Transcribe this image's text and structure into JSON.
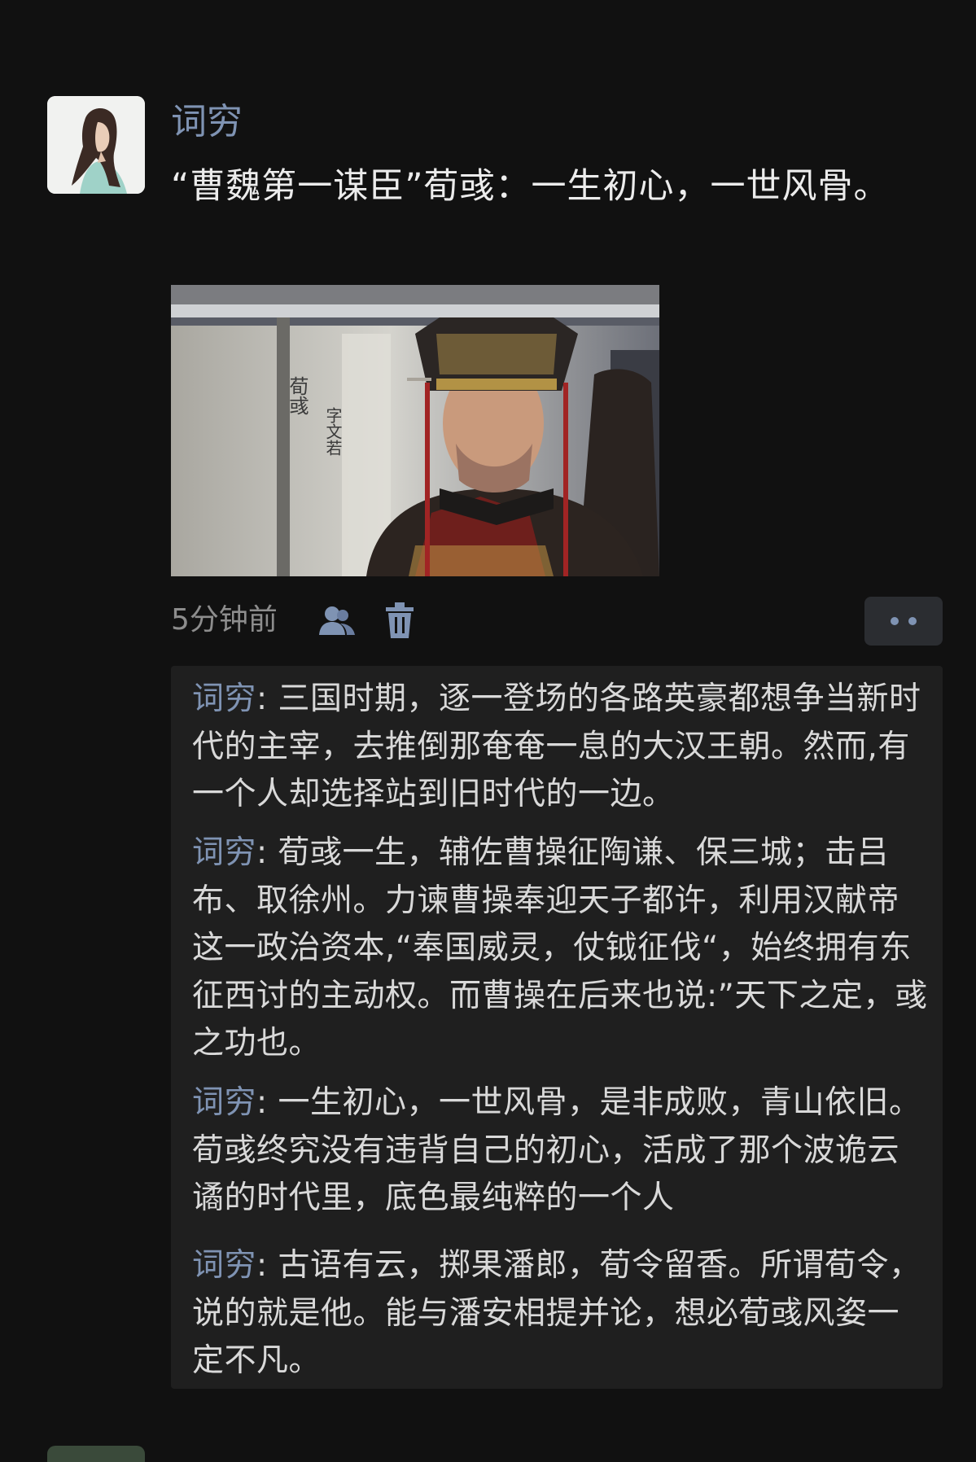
{
  "post": {
    "username": "词穷",
    "text": "“曹魏第一谋臣”荀彧：一生初心，一世风骨。",
    "photo": {
      "caption_name": "荀彧",
      "caption_courtesy": "字文若"
    },
    "timestamp": "5分钟前",
    "icons": {
      "friends": "friends-icon",
      "delete": "trash-icon",
      "more": "more-icon"
    }
  },
  "comments": [
    {
      "author": "词穷",
      "text": ": 三国时期，逐一登场的各路英豪都想争当新时代的主宰，去推倒那奄奄一息的大汉王朝。然而,有一个人却选择站到旧时代的一边。"
    },
    {
      "author": "词穷",
      "text": ": 荀彧一生，辅佐曹操征陶谦、保三城；击吕布、取徐州。力谏曹操奉迎天子都许，利用汉献帝这一政治资本,“奉国威灵，仗钺征伐“，始终拥有东征西讨的主动权。而曹操在后来也说:”天下之定，彧之功也。"
    },
    {
      "author": "词穷",
      "text": ": 一生初心，一世风骨，是非成败，青山依旧。荀彧终究没有违背自己的初心，活成了那个波诡云谲的时代里，底色最纯粹的一个人"
    },
    {
      "author": "词穷",
      "text": ": 古语有云，掷果潘郎，荀令留香。所谓荀令，说的就是他。能与潘安相提并论，想必荀彧风姿一定不凡。"
    }
  ],
  "colors": {
    "background": "#111111",
    "link_blue": "#7f93b3",
    "comment_bg": "#1f1f1f"
  }
}
